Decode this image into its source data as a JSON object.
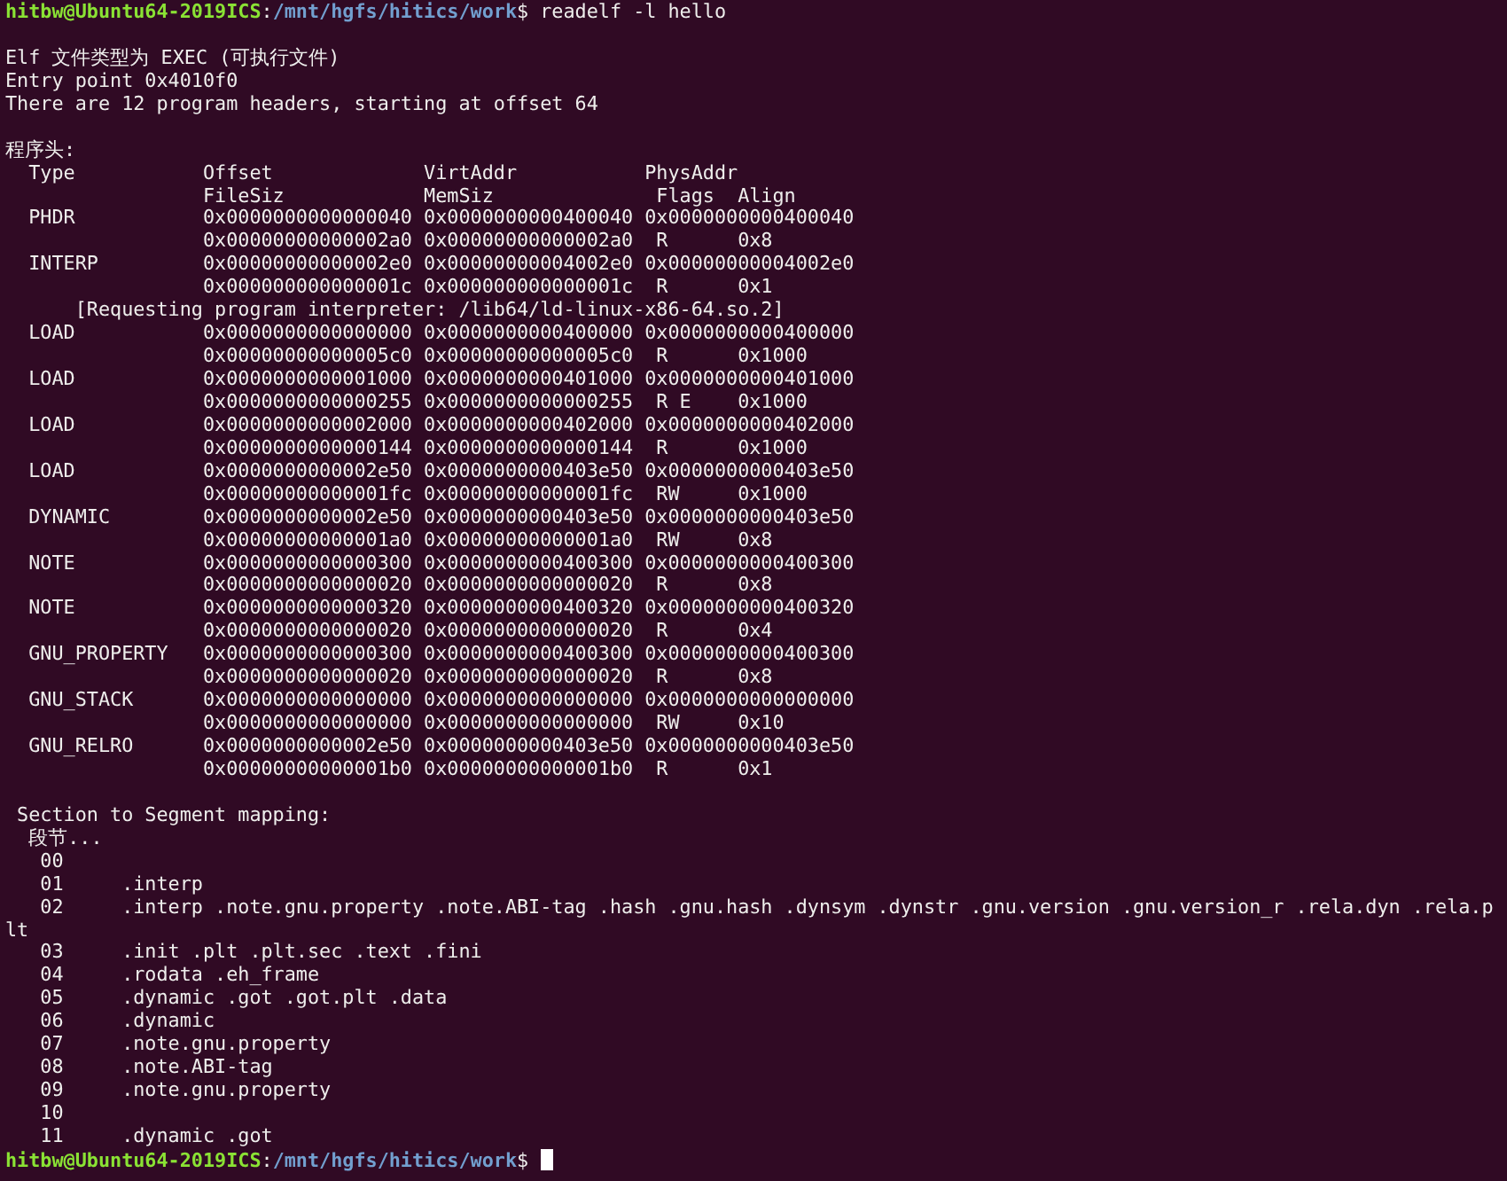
{
  "terminal": {
    "lines": [
      {
        "kind": "prompt",
        "user_host": "hitbw@Ubuntu64-2019ICS",
        "separator": ":",
        "path": "/mnt/hgfs/hitics/work",
        "symbol": "$",
        "command": "readelf -l hello",
        "cursor": false
      },
      {
        "kind": "blank"
      },
      {
        "kind": "text",
        "text": "Elf 文件类型为 EXEC (可执行文件)"
      },
      {
        "kind": "text",
        "text": "Entry point 0x4010f0"
      },
      {
        "kind": "text",
        "text": "There are 12 program headers, starting at offset 64"
      },
      {
        "kind": "blank"
      },
      {
        "kind": "text",
        "text": "程序头:"
      },
      {
        "kind": "text",
        "text": "  Type           Offset             VirtAddr           PhysAddr"
      },
      {
        "kind": "text",
        "text": "                 FileSiz            MemSiz              Flags  Align"
      },
      {
        "kind": "text",
        "text": "  PHDR           0x0000000000000040 0x0000000000400040 0x0000000000400040"
      },
      {
        "kind": "text",
        "text": "                 0x00000000000002a0 0x00000000000002a0  R      0x8"
      },
      {
        "kind": "text",
        "text": "  INTERP         0x00000000000002e0 0x00000000004002e0 0x00000000004002e0"
      },
      {
        "kind": "text",
        "text": "                 0x000000000000001c 0x000000000000001c  R      0x1"
      },
      {
        "kind": "text",
        "text": "      [Requesting program interpreter: /lib64/ld-linux-x86-64.so.2]"
      },
      {
        "kind": "text",
        "text": "  LOAD           0x0000000000000000 0x0000000000400000 0x0000000000400000"
      },
      {
        "kind": "text",
        "text": "                 0x00000000000005c0 0x00000000000005c0  R      0x1000"
      },
      {
        "kind": "text",
        "text": "  LOAD           0x0000000000001000 0x0000000000401000 0x0000000000401000"
      },
      {
        "kind": "text",
        "text": "                 0x0000000000000255 0x0000000000000255  R E    0x1000"
      },
      {
        "kind": "text",
        "text": "  LOAD           0x0000000000002000 0x0000000000402000 0x0000000000402000"
      },
      {
        "kind": "text",
        "text": "                 0x0000000000000144 0x0000000000000144  R      0x1000"
      },
      {
        "kind": "text",
        "text": "  LOAD           0x0000000000002e50 0x0000000000403e50 0x0000000000403e50"
      },
      {
        "kind": "text",
        "text": "                 0x00000000000001fc 0x00000000000001fc  RW     0x1000"
      },
      {
        "kind": "text",
        "text": "  DYNAMIC        0x0000000000002e50 0x0000000000403e50 0x0000000000403e50"
      },
      {
        "kind": "text",
        "text": "                 0x00000000000001a0 0x00000000000001a0  RW     0x8"
      },
      {
        "kind": "text",
        "text": "  NOTE           0x0000000000000300 0x0000000000400300 0x0000000000400300"
      },
      {
        "kind": "text",
        "text": "                 0x0000000000000020 0x0000000000000020  R      0x8"
      },
      {
        "kind": "text",
        "text": "  NOTE           0x0000000000000320 0x0000000000400320 0x0000000000400320"
      },
      {
        "kind": "text",
        "text": "                 0x0000000000000020 0x0000000000000020  R      0x4"
      },
      {
        "kind": "text",
        "text": "  GNU_PROPERTY   0x0000000000000300 0x0000000000400300 0x0000000000400300"
      },
      {
        "kind": "text",
        "text": "                 0x0000000000000020 0x0000000000000020  R      0x8"
      },
      {
        "kind": "text",
        "text": "  GNU_STACK      0x0000000000000000 0x0000000000000000 0x0000000000000000"
      },
      {
        "kind": "text",
        "text": "                 0x0000000000000000 0x0000000000000000  RW     0x10"
      },
      {
        "kind": "text",
        "text": "  GNU_RELRO      0x0000000000002e50 0x0000000000403e50 0x0000000000403e50"
      },
      {
        "kind": "text",
        "text": "                 0x00000000000001b0 0x00000000000001b0  R      0x1"
      },
      {
        "kind": "blank"
      },
      {
        "kind": "text",
        "text": " Section to Segment mapping:"
      },
      {
        "kind": "text",
        "text": "  段节..."
      },
      {
        "kind": "text",
        "text": "   00"
      },
      {
        "kind": "text",
        "text": "   01     .interp"
      },
      {
        "kind": "text",
        "text": "   02     .interp .note.gnu.property .note.ABI-tag .hash .gnu.hash .dynsym .dynstr .gnu.version .gnu.version_r .rela.dyn .rela.p"
      },
      {
        "kind": "text",
        "text": "lt"
      },
      {
        "kind": "text",
        "text": "   03     .init .plt .plt.sec .text .fini"
      },
      {
        "kind": "text",
        "text": "   04     .rodata .eh_frame"
      },
      {
        "kind": "text",
        "text": "   05     .dynamic .got .got.plt .data"
      },
      {
        "kind": "text",
        "text": "   06     .dynamic"
      },
      {
        "kind": "text",
        "text": "   07     .note.gnu.property"
      },
      {
        "kind": "text",
        "text": "   08     .note.ABI-tag"
      },
      {
        "kind": "text",
        "text": "   09     .note.gnu.property"
      },
      {
        "kind": "text",
        "text": "   10"
      },
      {
        "kind": "text",
        "text": "   11     .dynamic .got"
      },
      {
        "kind": "prompt",
        "user_host": "hitbw@Ubuntu64-2019ICS",
        "separator": ":",
        "path": "/mnt/hgfs/hitics/work",
        "symbol": "$",
        "cursor": true
      }
    ]
  }
}
